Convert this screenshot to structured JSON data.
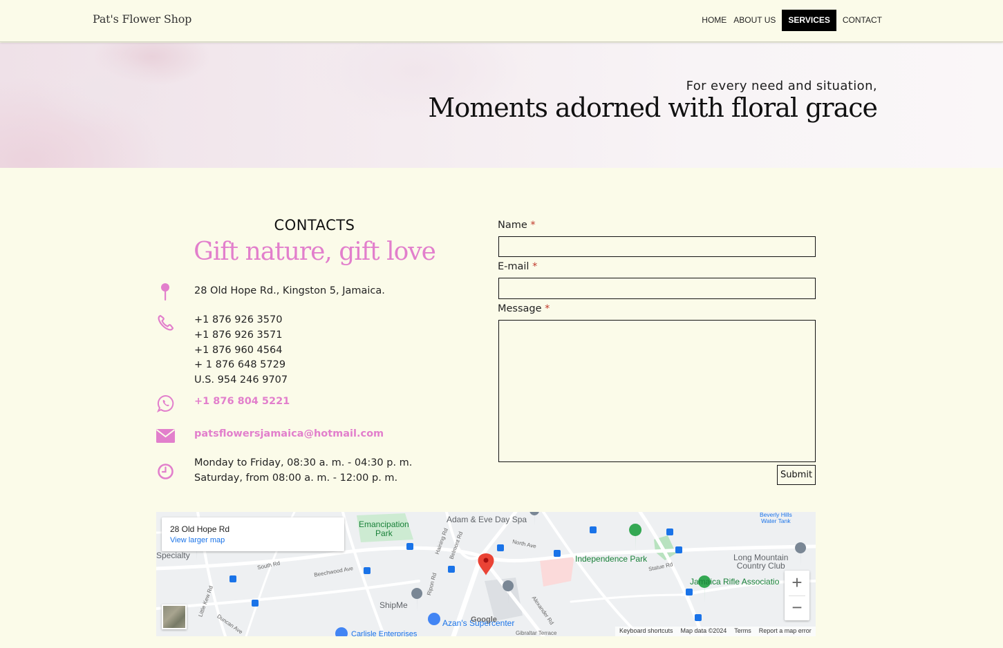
{
  "header": {
    "brand": "Pat's Flower Shop",
    "nav": [
      {
        "label": "HOME"
      },
      {
        "label": "ABOUT US"
      },
      {
        "label": "SERVICES"
      },
      {
        "label": "CONTACT"
      }
    ],
    "active_nav": "SERVICES"
  },
  "hero": {
    "subtitle": "For every need and situation,",
    "title": "Moments adorned with floral grace"
  },
  "contacts": {
    "heading": "CONTACTS",
    "tagline": "Gift nature, gift love",
    "address": "28 Old Hope Rd., Kingston 5, Jamaica.",
    "phones": [
      "+1 876 926 3570",
      "+1 876 926 3571",
      "+1 876 960 4564",
      "+ 1 876 648 5729",
      "U.S. 954 246 9707"
    ],
    "whatsapp": "+1 876 804 5221",
    "email": "patsflowersjamaica@hotmail.com",
    "hours": [
      "Monday to Friday, 08:30 a. m. - 04:30 p. m.",
      "Saturday, from 08:00 a. m. - 12:00 p. m."
    ],
    "icons": [
      "map-pin-icon",
      "phone-icon",
      "whatsapp-icon",
      "envelope-icon",
      "clock-icon"
    ],
    "accent_color": "#e27fcc"
  },
  "form": {
    "name_label": "Name",
    "email_label": "E-mail",
    "message_label": "Message",
    "required_mark": "*",
    "name_value": "",
    "email_value": "",
    "message_value": "",
    "submit_label": "Submit"
  },
  "map": {
    "card_title": "28 Old Hope Rd",
    "card_link": "View larger map",
    "zoom_in": "+",
    "zoom_out": "−",
    "footer": [
      "Keyboard shortcuts",
      "Map data ©2024",
      "Terms",
      "Report a map error"
    ],
    "labels": {
      "emancipation": "Emancipation Park",
      "emancipation_l1": "Emancipation",
      "emancipation_l2": "Park",
      "adam_eve": "Adam & Eve Day Spa",
      "beverly": "Beverly Hills Water Tank",
      "beverly_l1": "Beverly Hills",
      "beverly_l2": "Water Tank",
      "specialty": "Specialty",
      "independence": "Independence Park",
      "long_mountain_l1": "Long Mountain",
      "long_mountain_l2": "Country Club",
      "rifle": "Jamaica Rifle Associatio",
      "shipme": "ShipMe",
      "azans": "Azan's Supercenter",
      "google": "Google",
      "north_ave": "North Ave",
      "south_rd": "South Rd",
      "beechwood": "Beechwood Ave",
      "haining": "Haining Rd",
      "belmont": "Belmont Rd",
      "ripon": "Ripon Rd",
      "statue": "Statue Rd",
      "alexander": "Alexander Rd",
      "little_kew": "Little Kew Rd",
      "duncan": "Duncan Ave",
      "carlisle": "Carlisle Enterprises",
      "gibraltar": "Gibraltar Terrace"
    }
  }
}
